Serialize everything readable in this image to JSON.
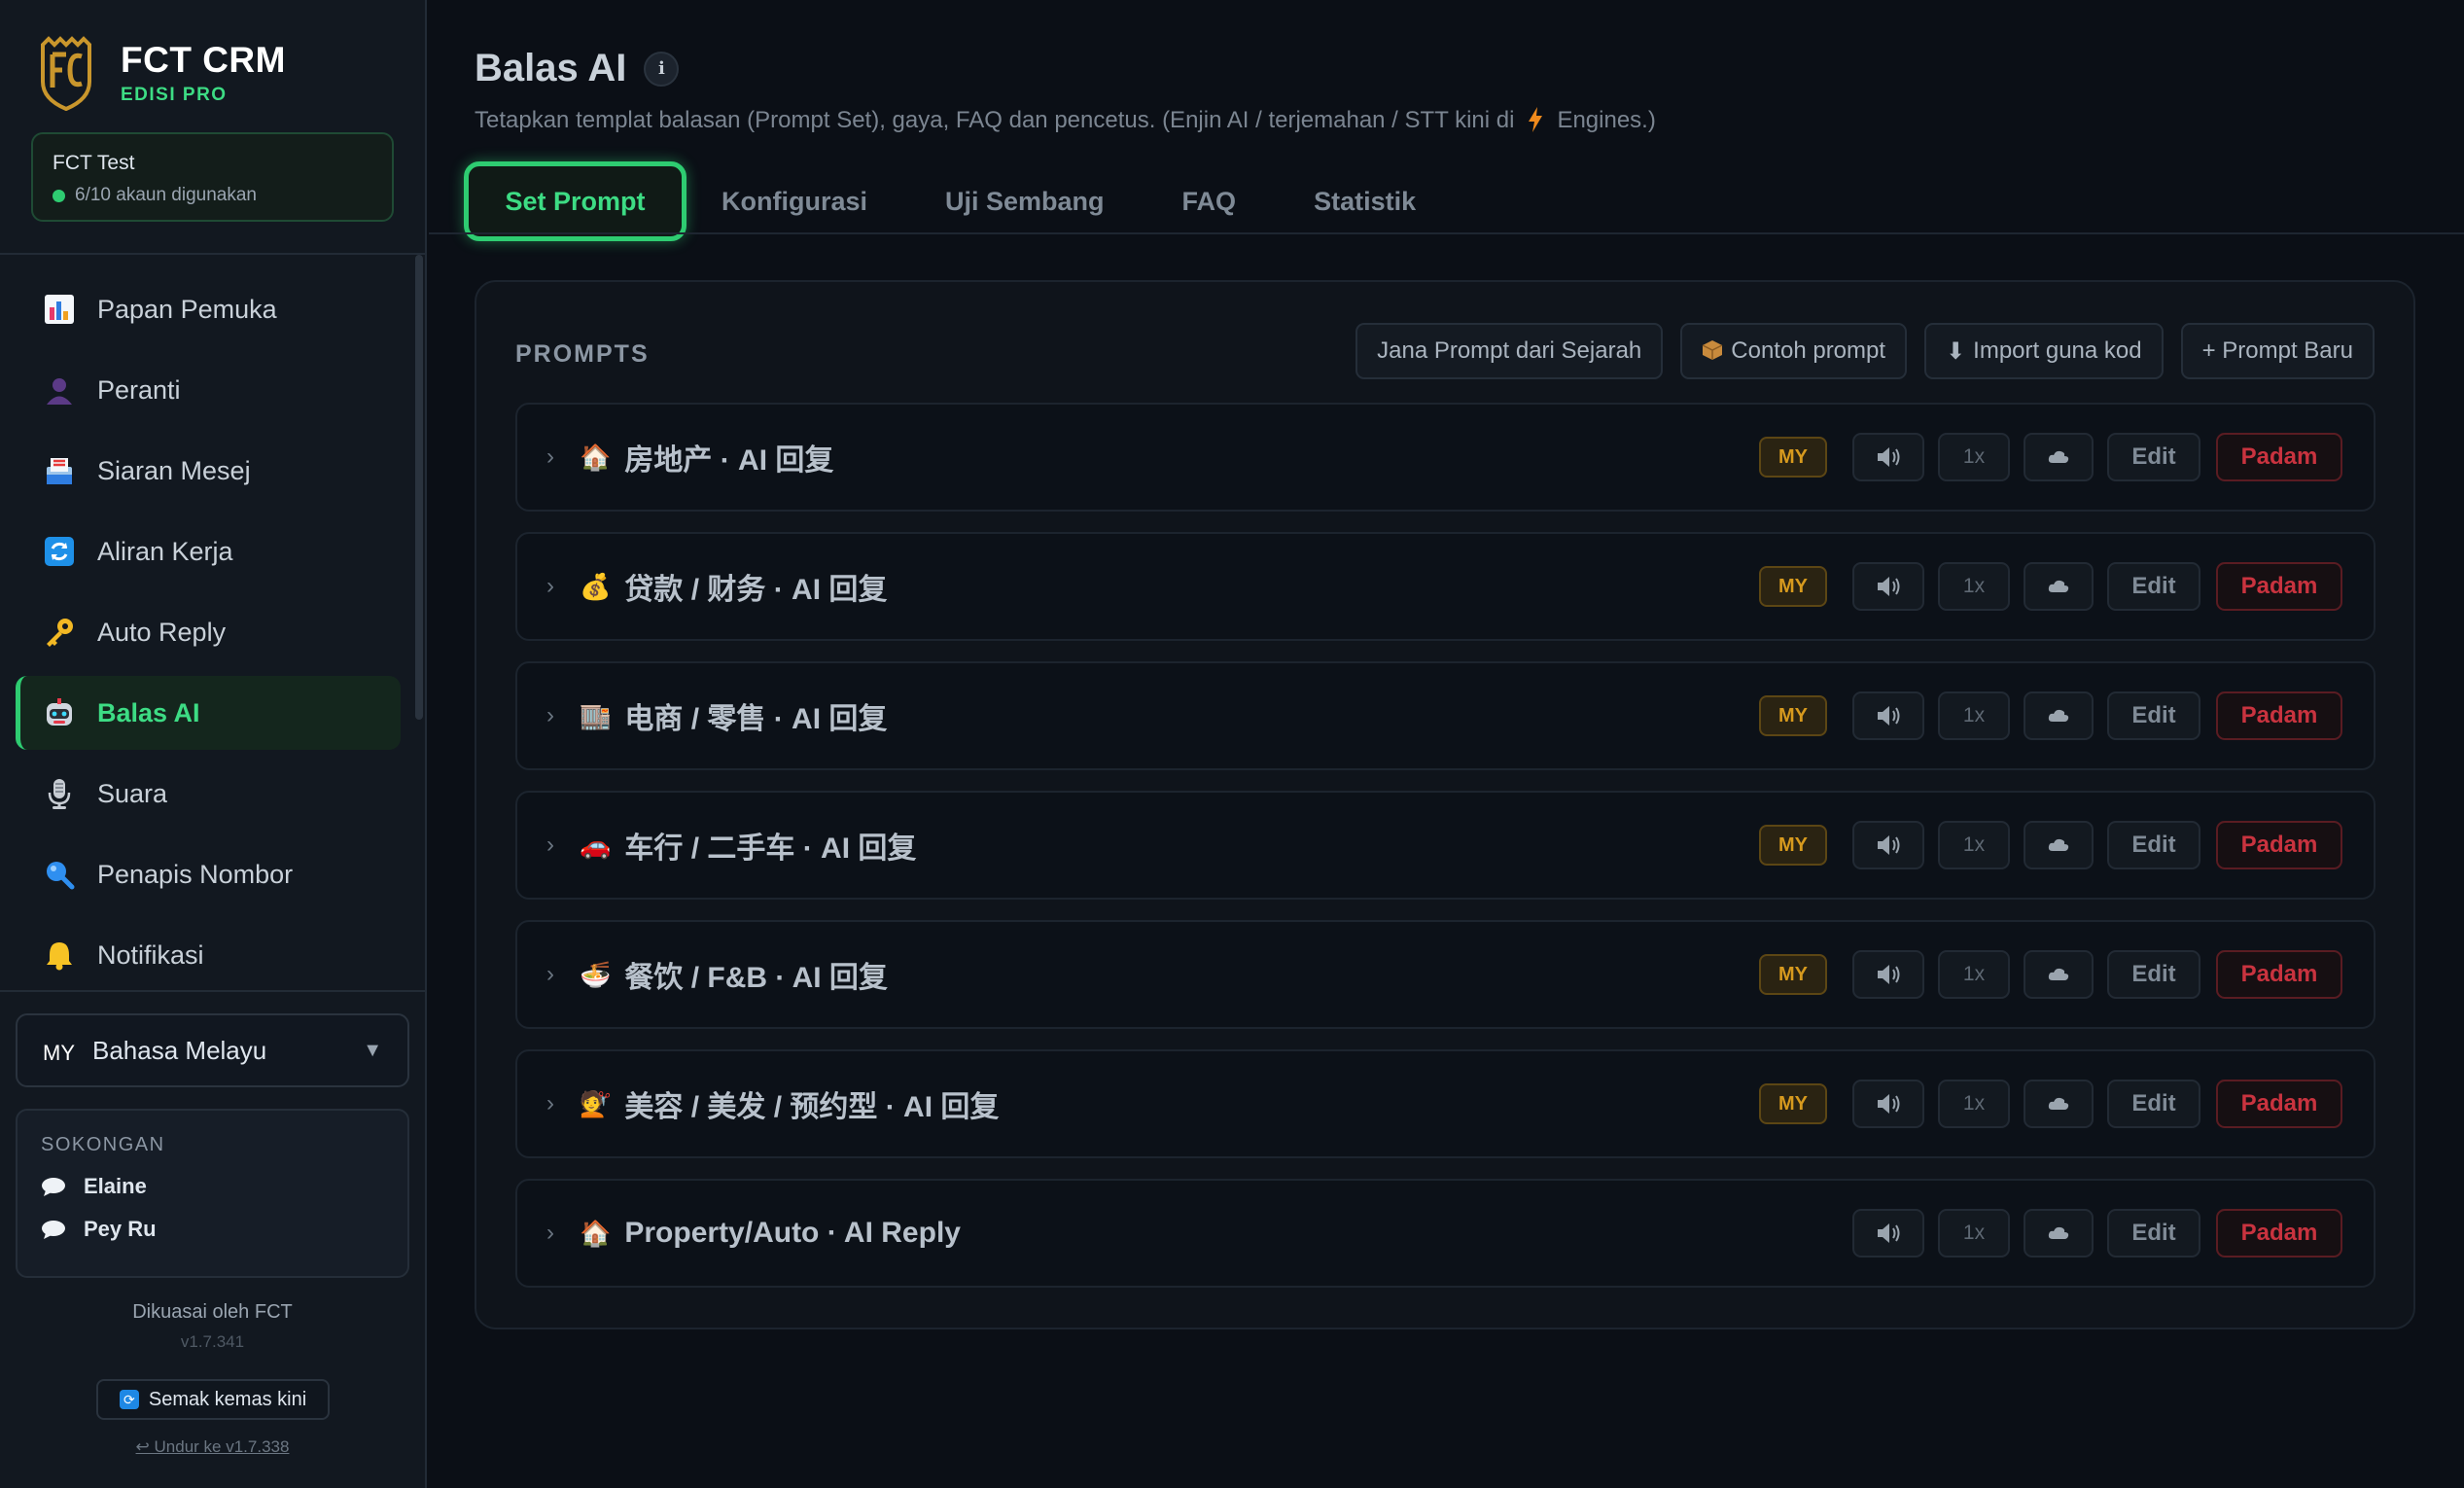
{
  "brand": {
    "name": "FCT CRM",
    "edition": "EDISI PRO"
  },
  "account": {
    "name": "FCT Test",
    "usage": "6/10 akaun digunakan"
  },
  "sidebar": {
    "items": [
      {
        "label": "Papan Pemuka",
        "icon": "dashboard-icon"
      },
      {
        "label": "Peranti",
        "icon": "device-person-icon"
      },
      {
        "label": "Siaran Mesej",
        "icon": "broadcast-inbox-icon"
      },
      {
        "label": "Aliran Kerja",
        "icon": "workflow-icon"
      },
      {
        "label": "Auto Reply",
        "icon": "key-icon"
      },
      {
        "label": "Balas AI",
        "icon": "robot-icon",
        "active": true
      },
      {
        "label": "Suara",
        "icon": "microphone-icon"
      },
      {
        "label": "Penapis Nombor",
        "icon": "magnifier-icon"
      },
      {
        "label": "Notifikasi",
        "icon": "bell-icon"
      }
    ]
  },
  "language": {
    "code": "MY",
    "label": "Bahasa Melayu",
    "caret": "▼"
  },
  "support": {
    "title": "SOKONGAN",
    "contacts": [
      "Elaine",
      "Pey Ru"
    ]
  },
  "footer": {
    "powered": "Dikuasai oleh FCT",
    "version": "v1.7.341",
    "check_update": "Semak kemas kini",
    "rollback": "↩ Undur ke v1.7.338"
  },
  "page": {
    "title": "Balas AI",
    "info": "i",
    "subtitle_before": "Tetapkan templat balasan (Prompt Set), gaya, FAQ dan pencetus. (Enjin AI / terjemahan / STT kini di",
    "subtitle_after": "Engines.)"
  },
  "tabs": [
    "Set Prompt",
    "Konfigurasi",
    "Uji Sembang",
    "FAQ",
    "Statistik"
  ],
  "panel": {
    "label": "PROMPTS",
    "actions": {
      "generate": "Jana Prompt dari Sejarah",
      "sample": "Contoh prompt",
      "import": "Import guna kod",
      "new": "+ Prompt Baru"
    }
  },
  "prompts": [
    {
      "emoji": "🏠",
      "title": "房地产 · AI 回复",
      "badge": "MY",
      "speed": "1x",
      "edit": "Edit",
      "delete": "Padam"
    },
    {
      "emoji": "💰",
      "title": "贷款 / 财务 · AI 回复",
      "badge": "MY",
      "speed": "1x",
      "edit": "Edit",
      "delete": "Padam"
    },
    {
      "emoji": "🏬",
      "title": "电商 / 零售 · AI 回复",
      "badge": "MY",
      "speed": "1x",
      "edit": "Edit",
      "delete": "Padam"
    },
    {
      "emoji": "🚗",
      "title": "车行 / 二手车 · AI 回复",
      "badge": "MY",
      "speed": "1x",
      "edit": "Edit",
      "delete": "Padam"
    },
    {
      "emoji": "🍜",
      "title": "餐饮 / F&B · AI 回复",
      "badge": "MY",
      "speed": "1x",
      "edit": "Edit",
      "delete": "Padam"
    },
    {
      "emoji": "💇",
      "title": "美容 / 美发 / 预约型 · AI 回复",
      "badge": "MY",
      "speed": "1x",
      "edit": "Edit",
      "delete": "Padam"
    },
    {
      "emoji": "🏠",
      "title": "Property/Auto · AI Reply",
      "badge": "",
      "speed": "1x",
      "edit": "Edit",
      "delete": "Padam"
    }
  ],
  "colors": {
    "accent": "#2ecc71",
    "danger": "#c9333f",
    "badge": "#d79a1e",
    "background": "#0b0f16"
  }
}
